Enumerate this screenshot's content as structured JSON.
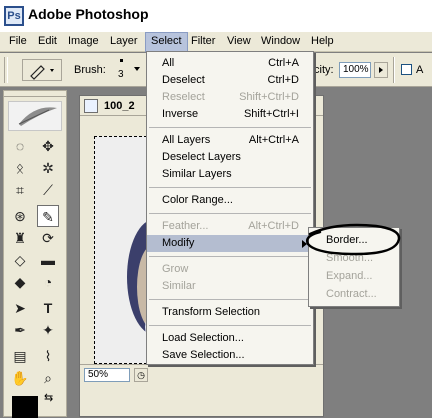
{
  "app": {
    "title": "Adobe Photoshop"
  },
  "menubar": {
    "items": [
      "File",
      "Edit",
      "Image",
      "Layer",
      "Select",
      "Filter",
      "View",
      "Window",
      "Help"
    ],
    "active": "Select"
  },
  "options": {
    "brush_label": "Brush:",
    "brush_size": "3",
    "opacity_label_partial": "city:",
    "opacity_value": "100%"
  },
  "document": {
    "tab_title": "100_2",
    "zoom": "50%"
  },
  "select_menu": {
    "items": [
      {
        "label": "All",
        "shortcut": "Ctrl+A",
        "disabled": false
      },
      {
        "label": "Deselect",
        "shortcut": "Ctrl+D",
        "disabled": false
      },
      {
        "label": "Reselect",
        "shortcut": "Shift+Ctrl+D",
        "disabled": true
      },
      {
        "label": "Inverse",
        "shortcut": "Shift+Ctrl+I",
        "disabled": false
      },
      {
        "label": "All Layers",
        "shortcut": "Alt+Ctrl+A",
        "disabled": false
      },
      {
        "label": "Deselect Layers",
        "shortcut": "",
        "disabled": false
      },
      {
        "label": "Similar Layers",
        "shortcut": "",
        "disabled": false
      },
      {
        "label": "Color Range...",
        "shortcut": "",
        "disabled": false
      },
      {
        "label": "Feather...",
        "shortcut": "Alt+Ctrl+D",
        "disabled": true
      },
      {
        "label": "Modify",
        "shortcut": "",
        "disabled": false
      },
      {
        "label": "Grow",
        "shortcut": "",
        "disabled": true
      },
      {
        "label": "Similar",
        "shortcut": "",
        "disabled": true
      },
      {
        "label": "Transform Selection",
        "shortcut": "",
        "disabled": false
      },
      {
        "label": "Load Selection...",
        "shortcut": "",
        "disabled": false
      },
      {
        "label": "Save Selection...",
        "shortcut": "",
        "disabled": false
      }
    ]
  },
  "modify_submenu": {
    "items": [
      {
        "label": "Border...",
        "disabled": false
      },
      {
        "label": "Smooth...",
        "disabled": true
      },
      {
        "label": "Expand...",
        "disabled": true
      },
      {
        "label": "Contract...",
        "disabled": true
      }
    ]
  },
  "colors": {
    "accent": "#b4bdd0",
    "annotation": "#000000"
  }
}
